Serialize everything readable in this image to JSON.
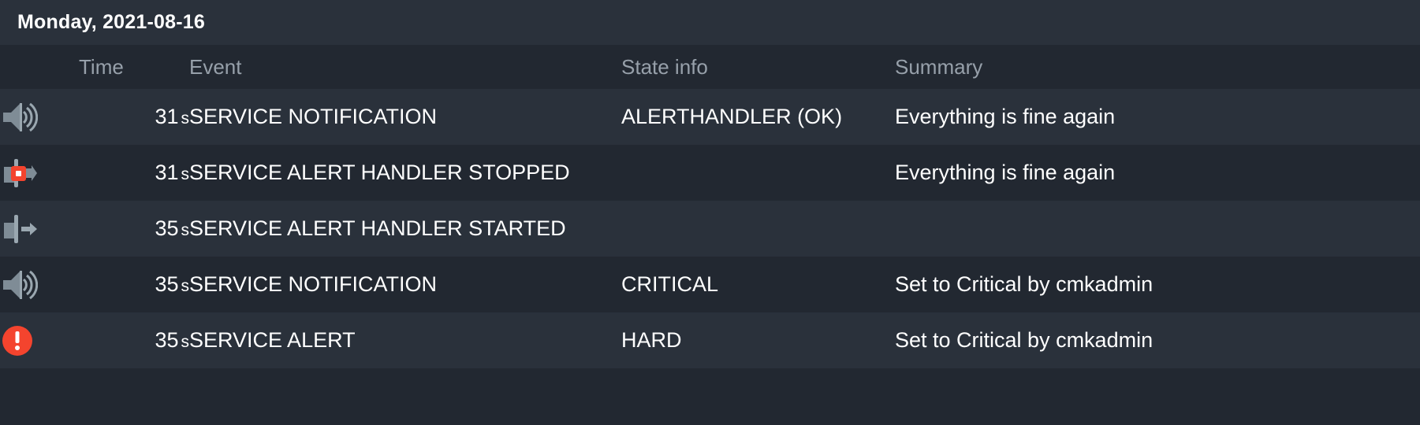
{
  "header": {
    "date_label": "Monday, 2021-08-16"
  },
  "colors": {
    "page_background": "#222831",
    "row_alt_background": "#2a313b",
    "header_background": "#2a313b",
    "column_header_text": "#97a0aa",
    "row_text": "#ffffff",
    "time_text": "#97a0aa",
    "icon_gray": "#7f8c96",
    "icon_gray_light": "#9aa7b0",
    "alert_red": "#f4442e",
    "icon_inner_white": "#ffffff"
  },
  "table": {
    "columns": [
      {
        "key": "icon",
        "label": ""
      },
      {
        "key": "time",
        "label": "Time"
      },
      {
        "key": "event",
        "label": "Event"
      },
      {
        "key": "state",
        "label": "State info"
      },
      {
        "key": "summary",
        "label": "Summary"
      }
    ],
    "rows": [
      {
        "icon": "speaker-notification-icon",
        "time_value": "31",
        "time_unit": "s",
        "event": "SERVICE NOTIFICATION",
        "state_info": "ALERTHANDLER (OK)",
        "summary": "Everything is fine again"
      },
      {
        "icon": "alert-handler-stopped-icon",
        "time_value": "31",
        "time_unit": "s",
        "event": "SERVICE ALERT HANDLER STOPPED",
        "state_info": "",
        "summary": "Everything is fine again"
      },
      {
        "icon": "alert-handler-started-icon",
        "time_value": "35",
        "time_unit": "s",
        "event": "SERVICE ALERT HANDLER STARTED",
        "state_info": "",
        "summary": ""
      },
      {
        "icon": "speaker-notification-icon",
        "time_value": "35",
        "time_unit": "s",
        "event": "SERVICE NOTIFICATION",
        "state_info": "CRITICAL",
        "summary": "Set to Critical by cmkadmin"
      },
      {
        "icon": "service-alert-icon",
        "time_value": "35",
        "time_unit": "s",
        "event": "SERVICE ALERT",
        "state_info": "HARD",
        "summary": "Set to Critical by cmkadmin"
      }
    ]
  }
}
